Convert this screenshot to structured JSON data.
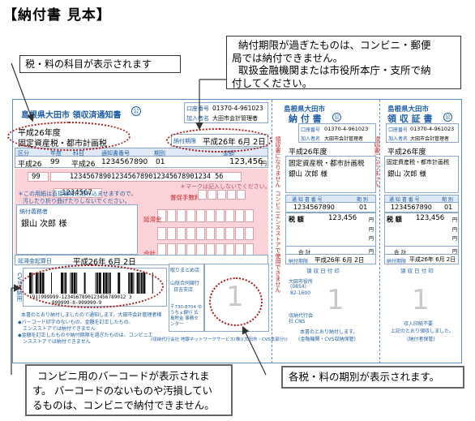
{
  "page_title": "【納付書 見本】",
  "callouts": {
    "subject": "税・料の科目が表示されます",
    "deadline_line1": "納付期限が過ぎたものは、コンビニ・郵便",
    "deadline_line2": "局では納付できません。",
    "deadline_line3": "取扱金融機関または市役所本庁・支所で納",
    "deadline_line4": "付してください。",
    "barcode_line1": "コンビニ用のバーコードが表示されま",
    "barcode_line2": "す。 バーコードのないものや汚損してい",
    "barcode_line3": "るものは、コンビニで納付できません。",
    "period": "各税・料の期別が表示されます。"
  },
  "slip_main": {
    "header": "島根県大田市  領収済通知書",
    "kouza_label": "口座番号",
    "kouza": "01370-4-961023",
    "kanyu_label": "加入者名",
    "kanyu": "大田市会計管理者",
    "year": "平成26年度",
    "subject": "固定資産税・都市計画税",
    "deadline_label": "納付期限",
    "deadline": "平成26年 6月 2日",
    "col_headers": [
      "区分",
      "年度",
      "科目",
      "通知書番号",
      "期別",
      "金額"
    ],
    "row": [
      "平成26",
      "99",
      "平成26",
      "1234567890",
      "01",
      "123,456"
    ],
    "yen": "円",
    "number_99": "99",
    "long_number": "1234567890123456789012345678901234 56",
    "short_number": "1234567",
    "mark_note": "＊マークは記入しないでください。",
    "tokusoku": "督促手数料",
    "entaikin": "延滞金",
    "gokei": "合計",
    "note1": "＊この用紙は直接機械に読み込ませますので、",
    "note2": "汚したり折り曲げたりしないでください。",
    "payer_label": "納付義務者",
    "payer": "銀山 次郎 様",
    "kisan_label": "延滞金起算日",
    "kisan": "平成26年 6月 2日",
    "cvs_side": "CVS収納用",
    "barcode_digits": "(91)999999-1234567890123456789012 3",
    "barcode_digits2": "999999-0-999999-9",
    "toriatsukai": "取りまとめ店",
    "bank": "山陰合同銀行",
    "bank2": "日吉支店",
    "center": "〒730-8704 ゆうちょ銀行 広島貯金 事務センター",
    "stamp_digit": "1",
    "foot1": "本書のとおり納付しましたので通知します。大田市会計管理者様",
    "foot2": "◆バーコード印字のないもの、金額を訂正したもの、",
    "foot3": "エンスストアでは納付できません",
    "foot4": "◆金額を訂正したものや納付期限を過ぎたものは、コンビニエ",
    "foot5": "ンスストアでは納付できません",
    "foot_center": "(収納代行会社 地銀ネットワークサービス(株)(大田市・CVS本部分))"
  },
  "slip_nofu": {
    "header1": "島根県大田市",
    "header2": "納 付 書",
    "kouza_label": "口座番号",
    "kouza": "01370-4-961023",
    "kanyu_label": "加入者名",
    "kanyu": "大田市会計管理者",
    "year": "平成26年度",
    "subject": "固定資産税・都市計画税",
    "payer": "銀山 次郎 様",
    "tsuchi_label": "通 知 書 番 号",
    "tsuchi": "1234567890",
    "kibetsu_label": "期 別",
    "kibetsu": "01",
    "zei_label": "税 額",
    "zei": "123,456",
    "gokei": "合 計",
    "deadline_label": "納付期限",
    "deadline": "平成26年 6月 2日",
    "ryoshu": "領 収 日 付 印",
    "city": "大田市役所",
    "city2": "(0854)",
    "city3": "82-1600",
    "stamp_digit": "1",
    "cns": "収納代行会社 CNS",
    "foot1": "本書のとおり納付します。",
    "foot2": "(金融機関・CVS収納保管)",
    "side_note": "領収書になりません",
    "side_note2": "コンビニエンスストアで使用できません",
    "yen": "円"
  },
  "slip_ryoshu": {
    "header1": "島根県大田市",
    "header2": "領 収 証 書",
    "kouza_label": "口座番号",
    "kouza": "01370-4-961023",
    "kanyu_label": "加入者名",
    "kanyu": "大田市会計管理者",
    "year": "平成26年度",
    "subject": "固定資産税・都市計画税",
    "payer": "銀山 次郎 様",
    "tsuchi_label": "通 知 書 番 号",
    "tsuchi": "1234567890",
    "kibetsu_label": "期 別",
    "kibetsu": "01",
    "zei_label": "税 額",
    "zei": "123,456",
    "gokei": "合 計",
    "deadline_label": "納付期限",
    "deadline": "平成26年 6月 2日",
    "ryoshu": "領 収 日 付 印",
    "stamp_digit": "1",
    "foot1": "収入印紙不要",
    "foot2": "上記のとおり領収しました。",
    "foot3": "(納付者保管)",
    "side_note": "領収書になりません",
    "yen": "円"
  }
}
